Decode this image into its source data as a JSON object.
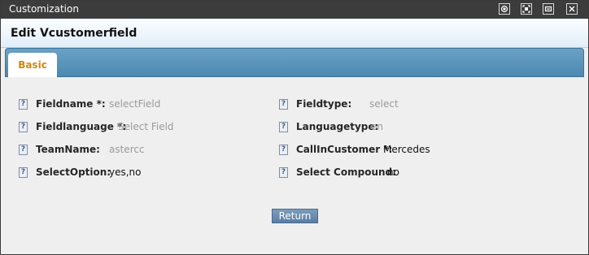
{
  "window": {
    "title": "Customization"
  },
  "header": {
    "title": "Edit Vcustomerfield"
  },
  "tabs": [
    {
      "label": "Basic"
    }
  ],
  "fields": {
    "fieldname": {
      "label": "Fieldname *:",
      "value": "selectField"
    },
    "fieldtype": {
      "label": "Fieldtype:",
      "value": "select"
    },
    "fieldlanguage": {
      "label": "Fieldlanguage *:",
      "value": "Select Field"
    },
    "languagetype": {
      "label": "Languagetype:",
      "value": "en"
    },
    "teamname": {
      "label": "TeamName:",
      "value": "astercc"
    },
    "callincustomer": {
      "label": "CallInCustomer *:",
      "value": "Mercedes"
    },
    "selectoption": {
      "label": "SelectOption:",
      "value": "yes,no"
    },
    "selectcompound": {
      "label": "Select Compound:",
      "value": "no"
    }
  },
  "help_icon_glyph": "?",
  "buttons": {
    "return_label": "Return"
  }
}
